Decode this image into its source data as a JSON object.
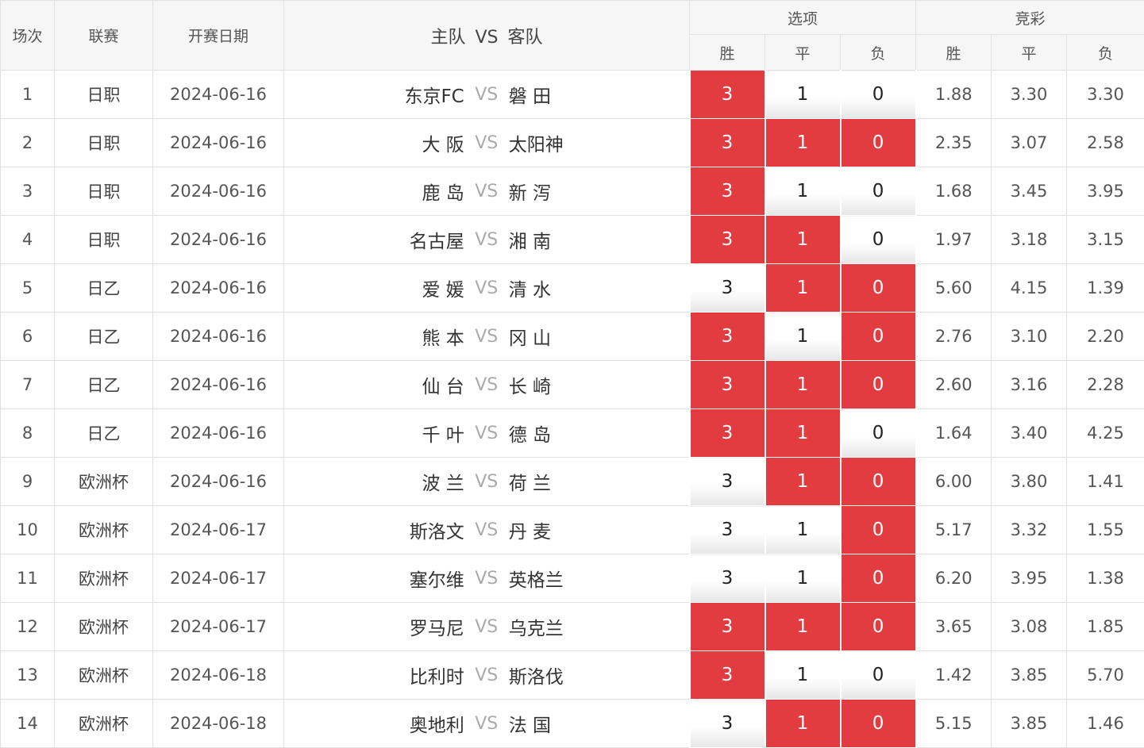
{
  "header": {
    "round": "场次",
    "league": "联赛",
    "date": "开赛日期",
    "home": "主队",
    "vs": "VS",
    "away": "客队",
    "options_group": "选项",
    "odds_group": "竞彩",
    "win": "胜",
    "draw": "平",
    "loss": "负"
  },
  "vs_label": "VS",
  "colors": {
    "selected": "#e23c41",
    "header_bg": "#f6f6f6"
  },
  "rows": [
    {
      "n": "1",
      "league": "日职",
      "date": "2024-06-16",
      "home": "东京FC",
      "away": "磐 田",
      "opt": [
        true,
        false,
        false
      ],
      "odds": [
        "1.88",
        "3.30",
        "3.30"
      ]
    },
    {
      "n": "2",
      "league": "日职",
      "date": "2024-06-16",
      "home": "大 阪",
      "away": "太阳神",
      "opt": [
        true,
        true,
        true
      ],
      "odds": [
        "2.35",
        "3.07",
        "2.58"
      ]
    },
    {
      "n": "3",
      "league": "日职",
      "date": "2024-06-16",
      "home": "鹿 岛",
      "away": "新 泻",
      "opt": [
        true,
        false,
        false
      ],
      "odds": [
        "1.68",
        "3.45",
        "3.95"
      ]
    },
    {
      "n": "4",
      "league": "日职",
      "date": "2024-06-16",
      "home": "名古屋",
      "away": "湘 南",
      "opt": [
        true,
        true,
        false
      ],
      "odds": [
        "1.97",
        "3.18",
        "3.15"
      ]
    },
    {
      "n": "5",
      "league": "日乙",
      "date": "2024-06-16",
      "home": "爱 媛",
      "away": "清 水",
      "opt": [
        false,
        true,
        true
      ],
      "odds": [
        "5.60",
        "4.15",
        "1.39"
      ]
    },
    {
      "n": "6",
      "league": "日乙",
      "date": "2024-06-16",
      "home": "熊 本",
      "away": "冈 山",
      "opt": [
        true,
        false,
        true
      ],
      "odds": [
        "2.76",
        "3.10",
        "2.20"
      ]
    },
    {
      "n": "7",
      "league": "日乙",
      "date": "2024-06-16",
      "home": "仙 台",
      "away": "长 崎",
      "opt": [
        true,
        true,
        true
      ],
      "odds": [
        "2.60",
        "3.16",
        "2.28"
      ]
    },
    {
      "n": "8",
      "league": "日乙",
      "date": "2024-06-16",
      "home": "千 叶",
      "away": "德 岛",
      "opt": [
        true,
        true,
        false
      ],
      "odds": [
        "1.64",
        "3.40",
        "4.25"
      ]
    },
    {
      "n": "9",
      "league": "欧洲杯",
      "date": "2024-06-16",
      "home": "波 兰",
      "away": "荷 兰",
      "opt": [
        false,
        true,
        true
      ],
      "odds": [
        "6.00",
        "3.80",
        "1.41"
      ]
    },
    {
      "n": "10",
      "league": "欧洲杯",
      "date": "2024-06-17",
      "home": "斯洛文",
      "away": "丹 麦",
      "opt": [
        false,
        false,
        true
      ],
      "odds": [
        "5.17",
        "3.32",
        "1.55"
      ]
    },
    {
      "n": "11",
      "league": "欧洲杯",
      "date": "2024-06-17",
      "home": "塞尔维",
      "away": "英格兰",
      "opt": [
        false,
        false,
        true
      ],
      "odds": [
        "6.20",
        "3.95",
        "1.38"
      ]
    },
    {
      "n": "12",
      "league": "欧洲杯",
      "date": "2024-06-17",
      "home": "罗马尼",
      "away": "乌克兰",
      "opt": [
        true,
        true,
        true
      ],
      "odds": [
        "3.65",
        "3.08",
        "1.85"
      ]
    },
    {
      "n": "13",
      "league": "欧洲杯",
      "date": "2024-06-18",
      "home": "比利时",
      "away": "斯洛伐",
      "opt": [
        true,
        false,
        false
      ],
      "odds": [
        "1.42",
        "3.85",
        "5.70"
      ]
    },
    {
      "n": "14",
      "league": "欧洲杯",
      "date": "2024-06-18",
      "home": "奥地利",
      "away": "法 国",
      "opt": [
        false,
        true,
        true
      ],
      "odds": [
        "5.15",
        "3.85",
        "1.46"
      ]
    }
  ],
  "option_values": [
    "3",
    "1",
    "0"
  ]
}
